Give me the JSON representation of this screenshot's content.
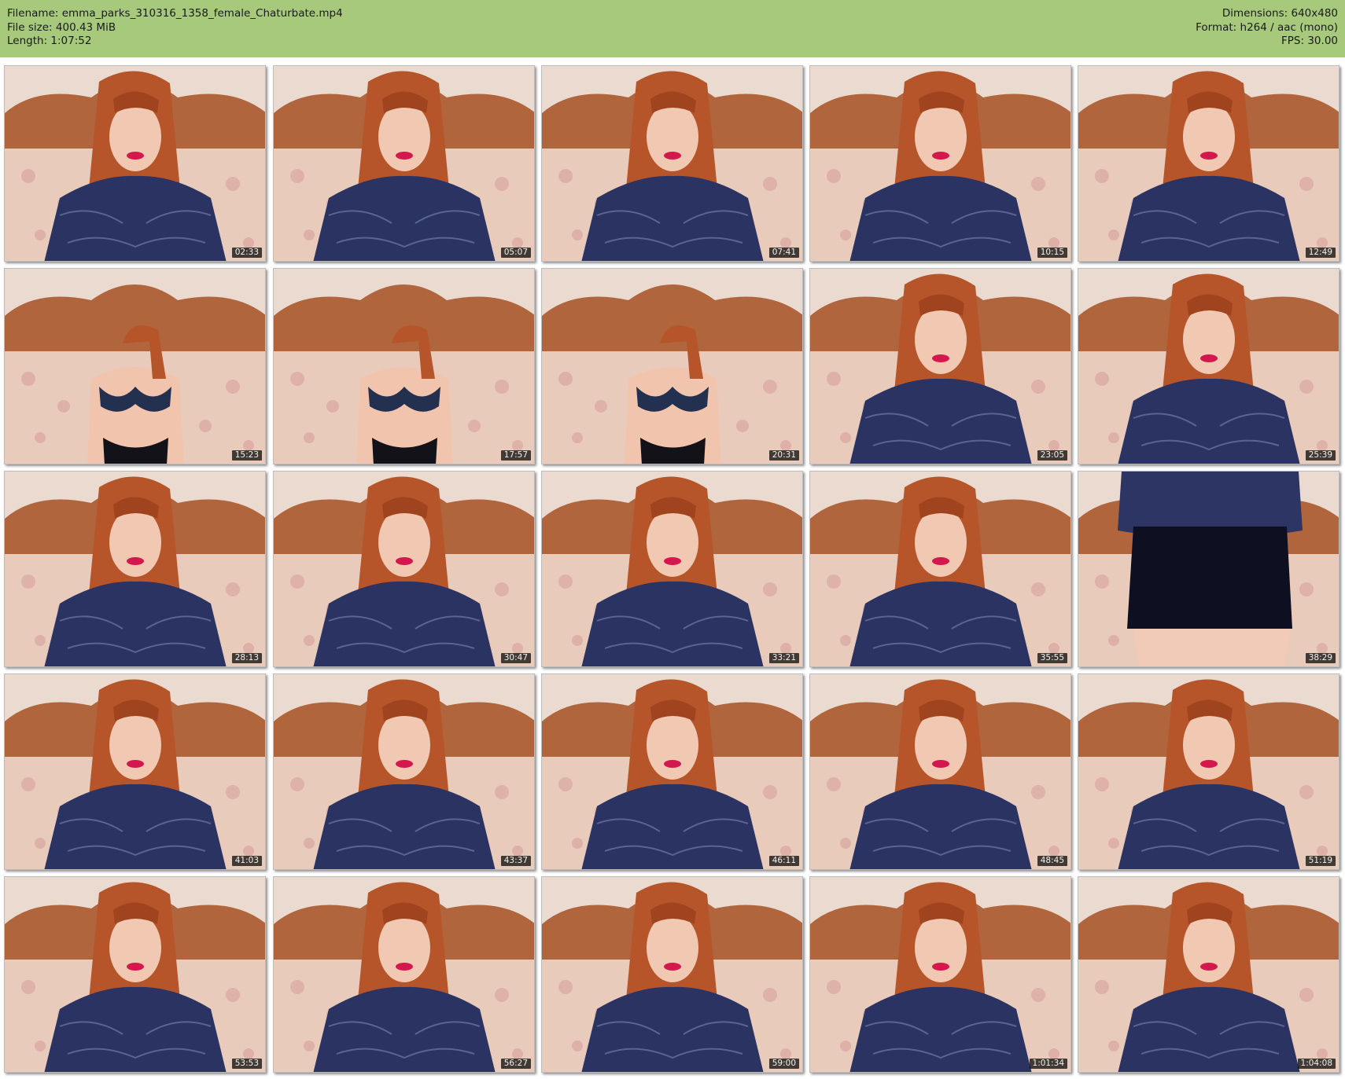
{
  "header": {
    "filename": "Filename: emma_parks_310316_1358_female_Chaturbate.mp4",
    "filesize": "File size: 400.43 MiB",
    "length": "Length: 1:07:52",
    "dimensions": "Dimensions: 640x480",
    "format": "Format: h264 / aac (mono)",
    "fps": "FPS: 30.00"
  },
  "colors": {
    "header_bg": "#a7c97c",
    "page_bg": "#ffffff",
    "timestamp_bg": "#000000"
  },
  "thumbnails": [
    {
      "timestamp": "02:33",
      "scene": "top"
    },
    {
      "timestamp": "05:07",
      "scene": "top"
    },
    {
      "timestamp": "07:41",
      "scene": "top"
    },
    {
      "timestamp": "10:15",
      "scene": "top"
    },
    {
      "timestamp": "12:49",
      "scene": "top"
    },
    {
      "timestamp": "15:23",
      "scene": "lingerie"
    },
    {
      "timestamp": "17:57",
      "scene": "lingerie"
    },
    {
      "timestamp": "20:31",
      "scene": "lingerie"
    },
    {
      "timestamp": "23:05",
      "scene": "top"
    },
    {
      "timestamp": "25:39",
      "scene": "top"
    },
    {
      "timestamp": "28:13",
      "scene": "top"
    },
    {
      "timestamp": "30:47",
      "scene": "top"
    },
    {
      "timestamp": "33:21",
      "scene": "top"
    },
    {
      "timestamp": "35:55",
      "scene": "top"
    },
    {
      "timestamp": "38:29",
      "scene": "skirt"
    },
    {
      "timestamp": "41:03",
      "scene": "top"
    },
    {
      "timestamp": "43:37",
      "scene": "top"
    },
    {
      "timestamp": "46:11",
      "scene": "top"
    },
    {
      "timestamp": "48:45",
      "scene": "top"
    },
    {
      "timestamp": "51:19",
      "scene": "top"
    },
    {
      "timestamp": "53:53",
      "scene": "top"
    },
    {
      "timestamp": "56:27",
      "scene": "top"
    },
    {
      "timestamp": "59:00",
      "scene": "top"
    },
    {
      "timestamp": "1:01:34",
      "scene": "top"
    },
    {
      "timestamp": "1:04:08",
      "scene": "top"
    }
  ]
}
